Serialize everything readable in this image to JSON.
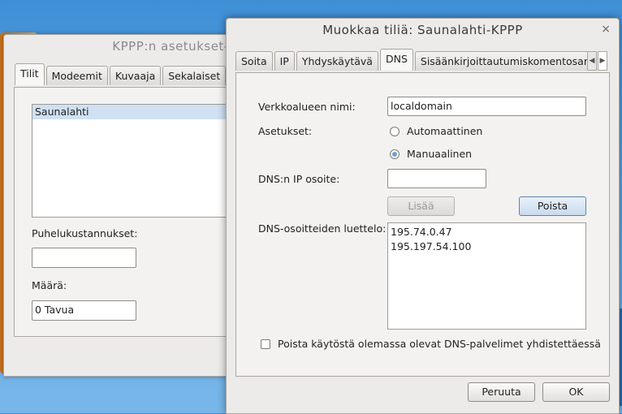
{
  "back_window": {
    "title": "KPPP:n asetukset-",
    "tabs": [
      {
        "label": "Tilit"
      },
      {
        "label": "Modeemit"
      },
      {
        "label": "Kuvaaja"
      },
      {
        "label": "Sekalaiset"
      }
    ],
    "accounts": [
      "Saunalahti"
    ],
    "phone_costs_label": "Puhelukustannukset:",
    "phone_costs_value": "",
    "amount_label": "Määrä:",
    "amount_value": "0 Tavua"
  },
  "dialog": {
    "title": "Muokkaa tiliä: Saunalahti-KPPP",
    "close_glyph": "×",
    "tabs": [
      {
        "label": "Soita"
      },
      {
        "label": "IP"
      },
      {
        "label": "Yhdyskäytävä"
      },
      {
        "label": "DNS"
      },
      {
        "label": "Sisäänkirjoittautumiskomentosarja"
      }
    ],
    "tab_scroll_left": "◀",
    "tab_scroll_right": "▶",
    "domain_label": "Verkkoalueen nimi:",
    "domain_value": "localdomain",
    "settings_label": "Asetukset:",
    "radio_auto": "Automaattinen",
    "radio_manual": "Manuaalinen",
    "dns_ip_label": "DNS:n IP osoite:",
    "dns_ip_value": "",
    "add_button": "Lisää",
    "remove_button": "Poista",
    "dns_list_label": "DNS-osoitteiden luettelo:",
    "dns_list": [
      "195.74.0.47",
      "195.197.54.100"
    ],
    "disable_dns_checkbox": "Poista käytöstä olemassa olevat DNS-palvelimet yhdistettäessä",
    "cancel_button": "Peruuta",
    "ok_button": "OK"
  }
}
